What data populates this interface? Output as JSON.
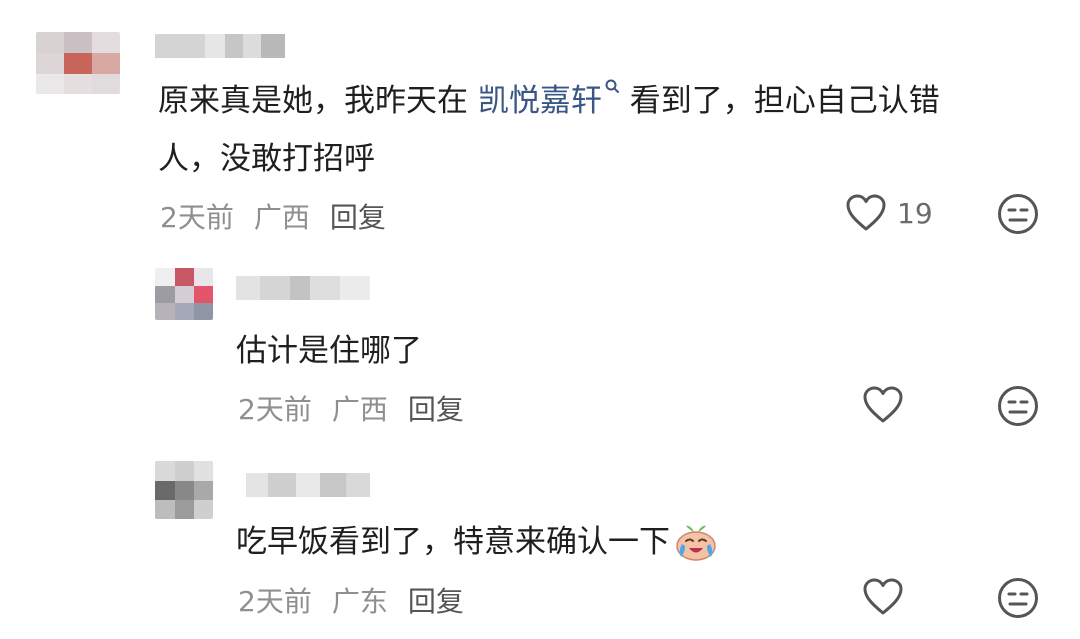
{
  "comments": [
    {
      "text_before_link": "原来真是她，我昨天在 ",
      "link_text": "凯悦嘉轩",
      "text_after_link": " 看到了，担心自己认错",
      "text_line2": "人，没敢打招呼",
      "time": "2天前",
      "location": "广西",
      "reply_label": "回复",
      "like_count": "19",
      "icons": {
        "like": "heart-outline-icon",
        "dislike": "neutral-face-icon",
        "search": "search-icon"
      }
    },
    {
      "text": "估计是住哪了",
      "time": "2天前",
      "location": "广西",
      "reply_label": "回复",
      "icons": {
        "like": "heart-outline-icon",
        "dislike": "neutral-face-icon"
      }
    },
    {
      "text": "吃早饭看到了，特意来确认一下",
      "time": "2天前",
      "location": "广东",
      "reply_label": "回复",
      "icons": {
        "like": "heart-outline-icon",
        "dislike": "neutral-face-icon",
        "emoji": "crying-laughing-emoji"
      }
    }
  ],
  "colors": {
    "text": "#1f1f1f",
    "meta": "#8f8f8f",
    "link": "#3a5685",
    "icon": "#555555"
  }
}
